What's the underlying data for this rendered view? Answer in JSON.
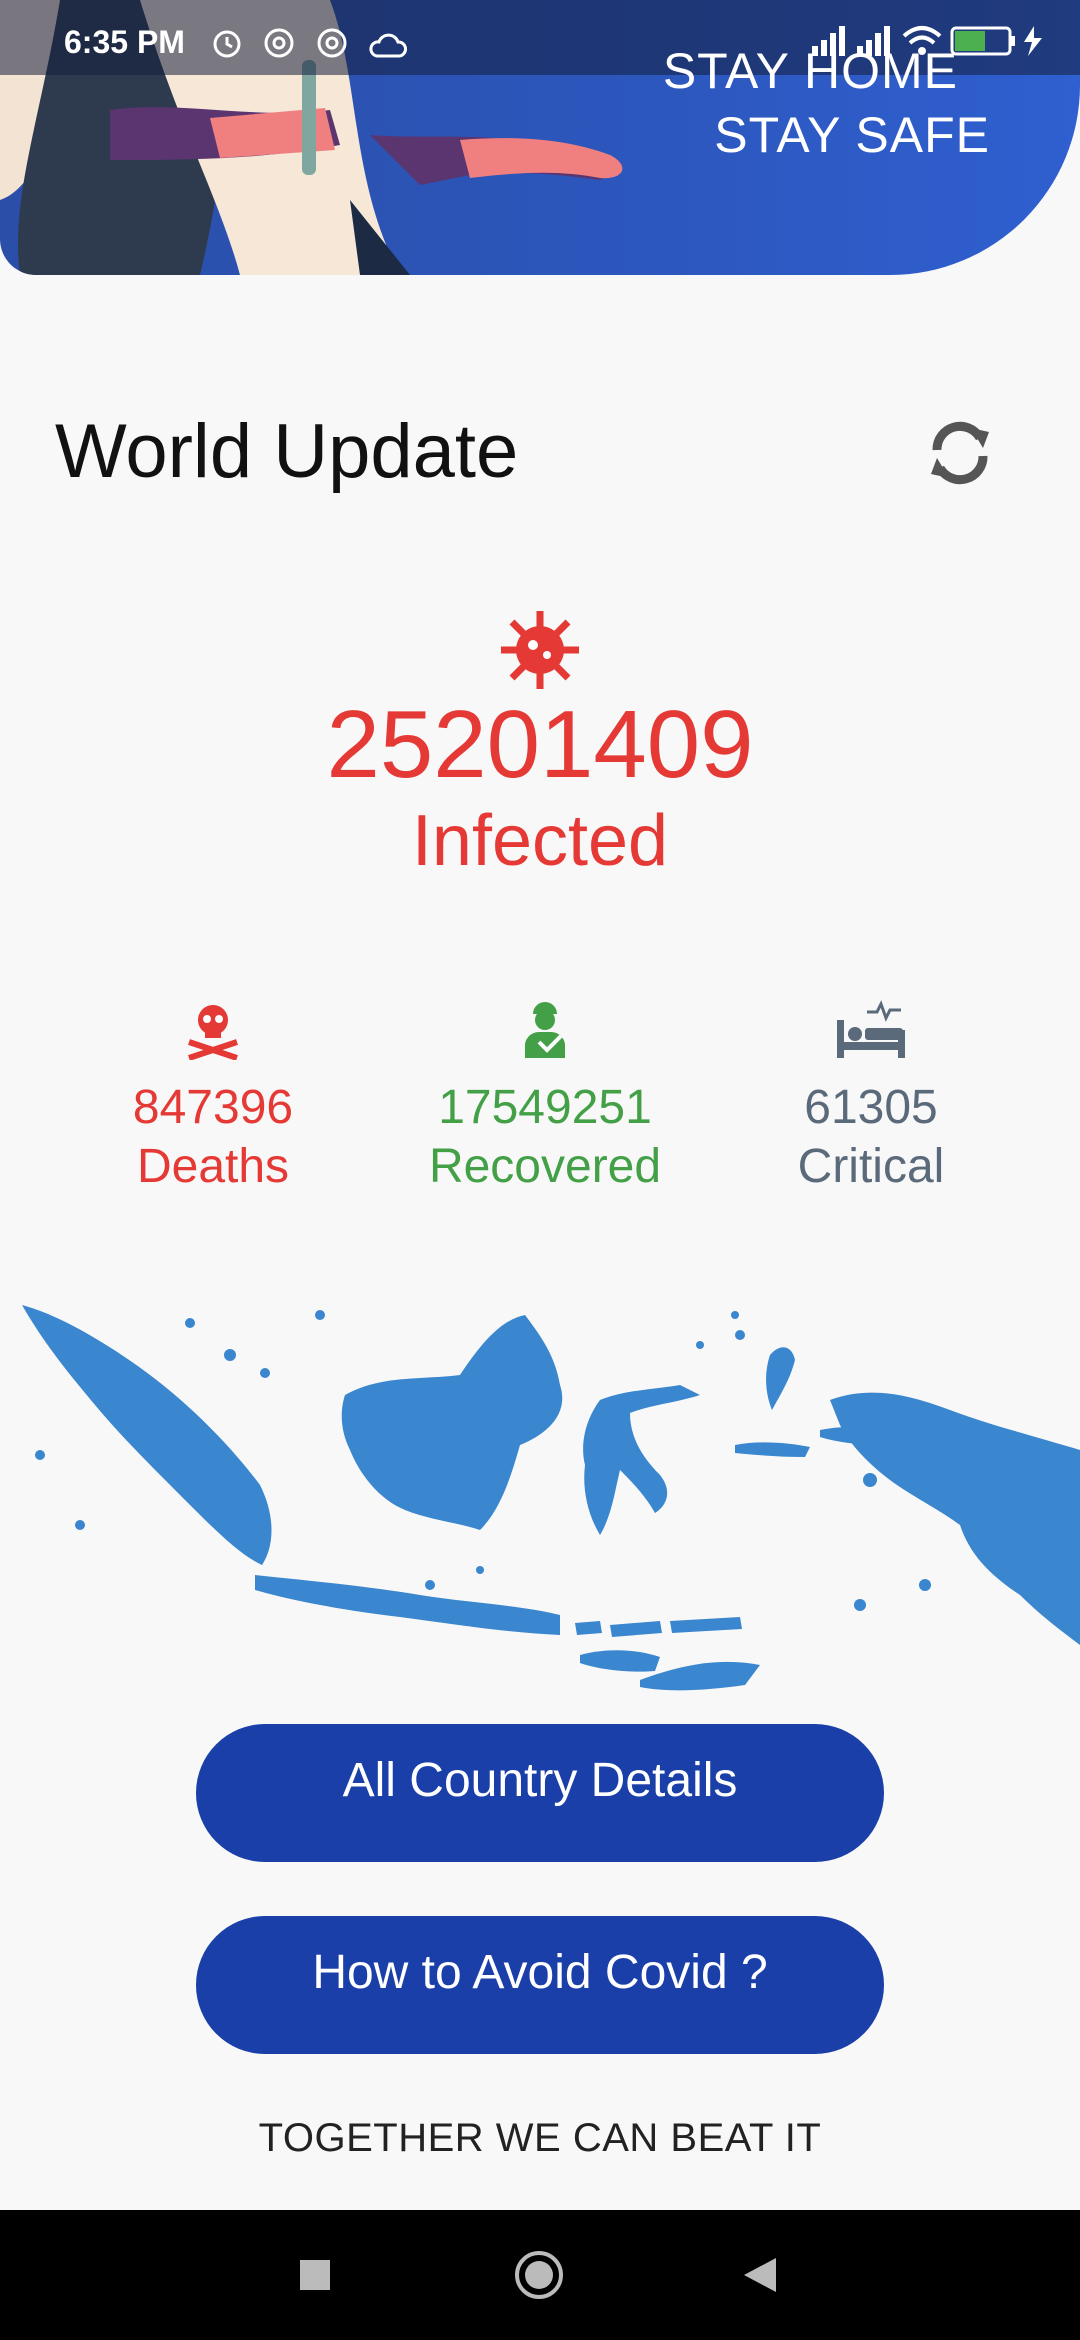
{
  "status_bar": {
    "time": "6:35 PM",
    "battery": "59",
    "icons": [
      "alarm-icon",
      "at-icon",
      "at-icon",
      "cloud-icon",
      "signal-icon",
      "signal-icon",
      "wifi-icon",
      "battery-icon",
      "charging-icon"
    ]
  },
  "banner": {
    "line1": "STAY HOME",
    "line2": "STAY SAFE"
  },
  "header": {
    "title": "World Update",
    "refresh_icon": "refresh-icon"
  },
  "infected": {
    "icon": "virus-icon",
    "value": "25201409",
    "label": "Infected"
  },
  "stats": [
    {
      "icon": "skull-icon",
      "value": "847396",
      "label": "Deaths",
      "color": "#e53935"
    },
    {
      "icon": "recovered-person-icon",
      "value": "17549251",
      "label": "Recovered",
      "color": "#43a047"
    },
    {
      "icon": "hospital-bed-icon",
      "value": "61305",
      "label": "Critical",
      "color": "#5a6a7a"
    }
  ],
  "buttons": {
    "all_country": "All Country Details",
    "avoid_covid": "How to Avoid Covid ?"
  },
  "footer": "TOGETHER WE CAN BEAT IT",
  "colors": {
    "banner": "#2c57bd",
    "button": "#1b3fa8",
    "map": "#3a86cf"
  }
}
